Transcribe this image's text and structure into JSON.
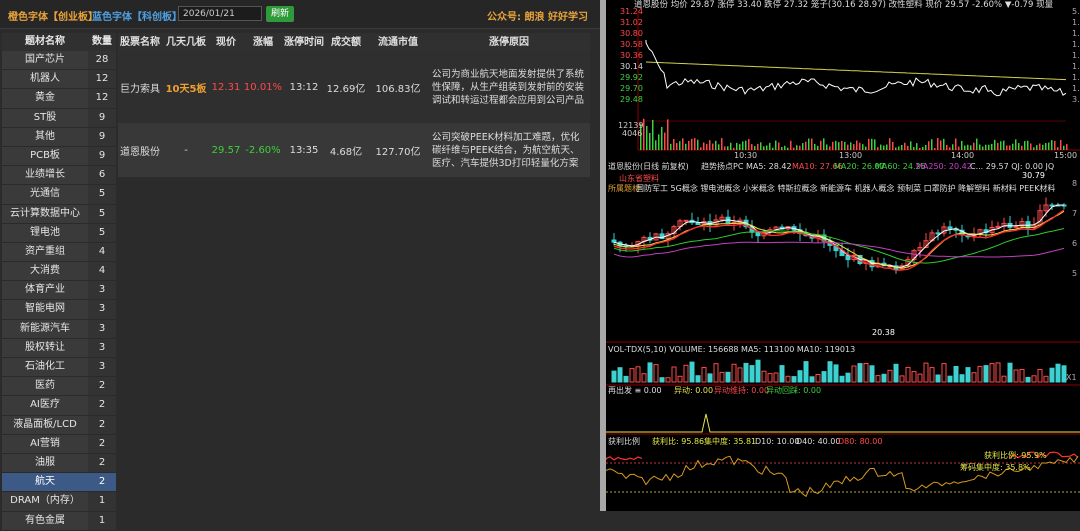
{
  "toolbar": {
    "board1": "橙色字体【创业板】",
    "board2": "蓝色字体【科创板】",
    "date": "2026/01/21",
    "refresh": "刷新",
    "public_account": "公众号: 朗浪 好好学习"
  },
  "sector_table": {
    "headers": [
      "题材名称",
      "数量"
    ],
    "rows": [
      {
        "name": "国产芯片",
        "count": "28"
      },
      {
        "name": "机器人",
        "count": "12"
      },
      {
        "name": "黄金",
        "count": "12"
      },
      {
        "name": "ST股",
        "count": "9"
      },
      {
        "name": "其他",
        "count": "9"
      },
      {
        "name": "PCB板",
        "count": "9"
      },
      {
        "name": "业绩增长",
        "count": "6"
      },
      {
        "name": "光通信",
        "count": "5"
      },
      {
        "name": "云计算数据中心",
        "count": "5"
      },
      {
        "name": "锂电池",
        "count": "5"
      },
      {
        "name": "资产重组",
        "count": "4"
      },
      {
        "name": "大消费",
        "count": "4"
      },
      {
        "name": "体育产业",
        "count": "3"
      },
      {
        "name": "智能电网",
        "count": "3"
      },
      {
        "name": "新能源汽车",
        "count": "3"
      },
      {
        "name": "股权转让",
        "count": "3"
      },
      {
        "name": "石油化工",
        "count": "3"
      },
      {
        "name": "医药",
        "count": "2"
      },
      {
        "name": "AI医疗",
        "count": "2"
      },
      {
        "name": "液晶面板/LCD",
        "count": "2"
      },
      {
        "name": "AI营销",
        "count": "2"
      },
      {
        "name": "油服",
        "count": "2"
      },
      {
        "name": "航天",
        "count": "2"
      },
      {
        "name": "DRAM（内存）",
        "count": "1"
      },
      {
        "name": "有色金属",
        "count": "1"
      }
    ],
    "selected_index": 22
  },
  "stock_table": {
    "headers": [
      "股票名称",
      "几天几板",
      "现价",
      "涨幅",
      "涨停时间",
      "成交额",
      "流通市值",
      "涨停原因"
    ],
    "rows": [
      {
        "name": "巨力索具",
        "boards": "10天5板",
        "price": "12.31",
        "change": "10.01%",
        "time": "13:12",
        "turnover": "12.69亿",
        "cap": "106.83亿",
        "reason": "公司为商业航天地面发射提供了系统性保障，从生产组装到发射前的安装调试和转运过程都会应用到公司产品"
      },
      {
        "name": "道恩股份",
        "boards": "-",
        "price": "29.57",
        "change": "-2.60%",
        "time": "13:35",
        "turnover": "4.68亿",
        "cap": "127.70亿",
        "reason": "公司突破PEEK材料加工难题，优化碳纤维与PEEK结合，为航空航天、医疗、汽车提供3D打印轻量化方案"
      }
    ]
  },
  "intraday": {
    "header": "道恩股份  均价 29.87 涨停 33.40 跌停 27.32 笼子(30.16 28.97) 改性塑料 现价 29.57 -2.60% ▼-0.79 现量",
    "y_labels": [
      "31.24",
      "31.02",
      "30.80",
      "30.58",
      "30.36",
      "30.14",
      "29.92",
      "29.70",
      "29.48"
    ],
    "right_labels": [
      "5.",
      "1.",
      "1.",
      "1.",
      "1.",
      "1.",
      "1.",
      "1.",
      "3."
    ],
    "vol_labels": [
      "12139",
      "4046"
    ],
    "time_labels": [
      "10:30",
      "13:00",
      "14:00",
      "15:00"
    ]
  },
  "kline": {
    "header_name": "道恩股份(日线 前复权)",
    "header_ind": "趋势扬点PC MA5: 28.42",
    "ma10": "MA10: 27.66",
    "ma20": "MA20: 26.07",
    "ma60": "MA60: 24.26",
    "ma250": "MA250: 20.42",
    "ma_end": "C... 29.57  QJ: 0.00  JQ",
    "label_peak": "山东省塑料",
    "concepts_prefix": "所属题材",
    "concepts": "国防军工 5G概念 锂电池概念 小米概念 特斯拉概念 新能源车 机器人概念 预制菜 口罩防护 降解塑料 新材料 PEEK材料",
    "high_label": "30.79",
    "low_label": "20.38",
    "right_labels": [
      "8",
      "7",
      "6",
      "5"
    ]
  },
  "volume_panel": {
    "header": "VOL-TDX(5,10)  VOLUME: 156688  MA5: 113100  MA10: 119013",
    "right_label": "X1"
  },
  "signal_panel": {
    "name": "再出发 ≡ 0.00",
    "item1": "异动: 0.00",
    "item2": "异动维持: 0.00",
    "item3": "异动回踩: 0.00"
  },
  "profit_panel": {
    "name": "获利比例",
    "profit": "获利比: 95.86",
    "concentration": "集中度: 35.81",
    "d10": "D10: 10.00",
    "d40": "D40: 40.00",
    "d80": "D80: 80.00",
    "right1": "获利比例: 95.9%",
    "right2": "筹码集中度: 35.8%"
  },
  "colors": {
    "up": "#ff4a4a",
    "down": "#3dd13d",
    "accent": "#e8a33a",
    "blue": "#4f9fe0"
  }
}
